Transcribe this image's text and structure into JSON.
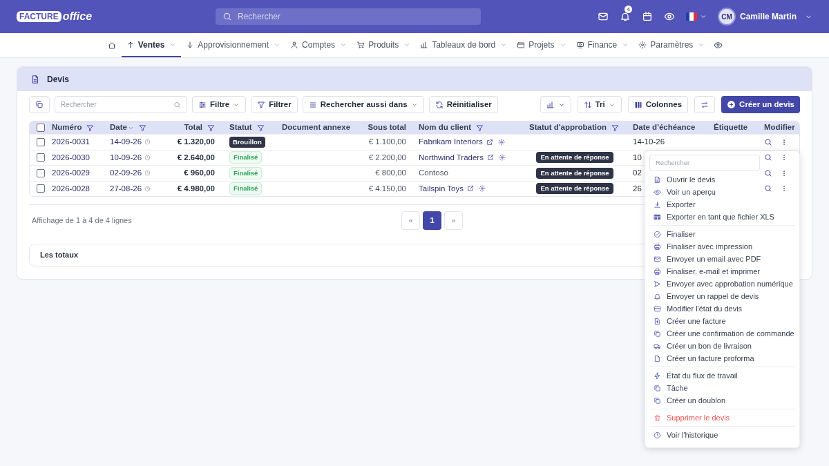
{
  "header": {
    "logo": {
      "part1": "FACTURE",
      "part2": "office"
    },
    "search": {
      "placeholder": "Rechercher"
    },
    "notifications": "4",
    "user": {
      "initials": "CM",
      "name": "Camille Martin"
    }
  },
  "nav": {
    "items": [
      {
        "label": "Ventes",
        "selected": true
      },
      {
        "label": "Approvisionnement",
        "selected": false
      },
      {
        "label": "Comptes",
        "selected": false
      },
      {
        "label": "Produits",
        "selected": false
      },
      {
        "label": "Tableaux de bord",
        "selected": false
      },
      {
        "label": "Projets",
        "selected": false
      },
      {
        "label": "Finance",
        "selected": false
      },
      {
        "label": "Paramètres",
        "selected": false
      }
    ]
  },
  "card": {
    "title": "Devis"
  },
  "toolbar": {
    "search": {
      "placeholder": "Rechercher"
    },
    "left_buttons": [
      "Filtre",
      "Filtrer",
      "Rechercher aussi dans",
      "Réinitialiser"
    ],
    "sort": "Tri",
    "columns": "Colonnes",
    "create": "Créer un devis"
  },
  "table": {
    "all_checked": false,
    "columns": [
      "Numéro",
      "Date",
      "Total",
      "Statut",
      "Document annexe",
      "Sous total",
      "Nom du client",
      "Statut d'approbation",
      "Date d'échéance",
      "Étiquette",
      "Modifier"
    ],
    "rows": [
      {
        "number": "2026-0031",
        "date": "14-09-26",
        "total": "€ 1.320,00",
        "status": {
          "label": "Brouillon",
          "kind": "draft"
        },
        "subtotal": "€ 1.100,00",
        "client": "Fabrikam Interiors",
        "client_linked": true,
        "due": "14-10-26",
        "checked": false
      },
      {
        "number": "2026-0030",
        "date": "10-09-26",
        "total": "€ 2.640,00",
        "status": {
          "label": "Finalisé",
          "kind": "final"
        },
        "subtotal": "€ 2.200,00",
        "client": "Northwind Traders",
        "client_linked": true,
        "approval": "En attente de réponse",
        "due": "10",
        "checked": false
      },
      {
        "number": "2026-0029",
        "date": "02-09-26",
        "total": "€ 960,00",
        "status": {
          "label": "Finalisé",
          "kind": "final"
        },
        "subtotal": "€ 800,00",
        "client": "Contoso",
        "client_linked": false,
        "approval": "En attente de réponse",
        "due": "02",
        "checked": false
      },
      {
        "number": "2026-0028",
        "date": "27-08-26",
        "total": "€ 4.980,00",
        "status": {
          "label": "Finalisé",
          "kind": "final"
        },
        "subtotal": "€ 4.150,00",
        "client": "Tailspin Toys",
        "client_linked": true,
        "approval": "En attente de réponse",
        "due": "26",
        "checked": false
      }
    ]
  },
  "footer": {
    "info": "Affichage de 1 à 4 de 4 lignes",
    "pages": [
      {
        "label": "«",
        "selected": false
      },
      {
        "label": "1",
        "selected": true
      },
      {
        "label": "»",
        "selected": false
      }
    ]
  },
  "totals": {
    "title": "Les totaux"
  },
  "action_menu": {
    "search_placeholder": "Rechercher",
    "groups": [
      [
        {
          "label": "Ouvrir le devis",
          "kind": "normal"
        },
        {
          "label": "Voir un aperçu",
          "kind": "normal"
        },
        {
          "label": "Exporter",
          "kind": "normal"
        },
        {
          "label": "Exporter en tant que fichier XLS",
          "kind": "normal"
        }
      ],
      [
        {
          "label": "Finaliser",
          "kind": "normal"
        },
        {
          "label": "Finaliser avec impression",
          "kind": "normal"
        },
        {
          "label": "Envoyer un email avec PDF",
          "kind": "normal"
        },
        {
          "label": "Finaliser, e-mail et imprimer",
          "kind": "normal"
        },
        {
          "label": "Envoyer avec approbation numérique",
          "kind": "normal"
        },
        {
          "label": "Envoyer un rappel de devis",
          "kind": "normal"
        },
        {
          "label": "Modifier l'état du devis",
          "kind": "normal"
        },
        {
          "label": "Créer une facture",
          "kind": "normal"
        },
        {
          "label": "Créer une confirmation de commande",
          "kind": "normal"
        },
        {
          "label": "Créer un bon de livraison",
          "kind": "normal"
        },
        {
          "label": "Créer un facture proforma",
          "kind": "normal"
        }
      ],
      [
        {
          "label": "État du flux de travail",
          "kind": "normal"
        },
        {
          "label": "Tâche",
          "kind": "normal"
        },
        {
          "label": "Créer un doublon",
          "kind": "normal"
        }
      ],
      [
        {
          "label": "Supprimer le devis",
          "kind": "danger"
        }
      ],
      [
        {
          "label": "Voir l'historique",
          "kind": "normal"
        }
      ]
    ]
  }
}
